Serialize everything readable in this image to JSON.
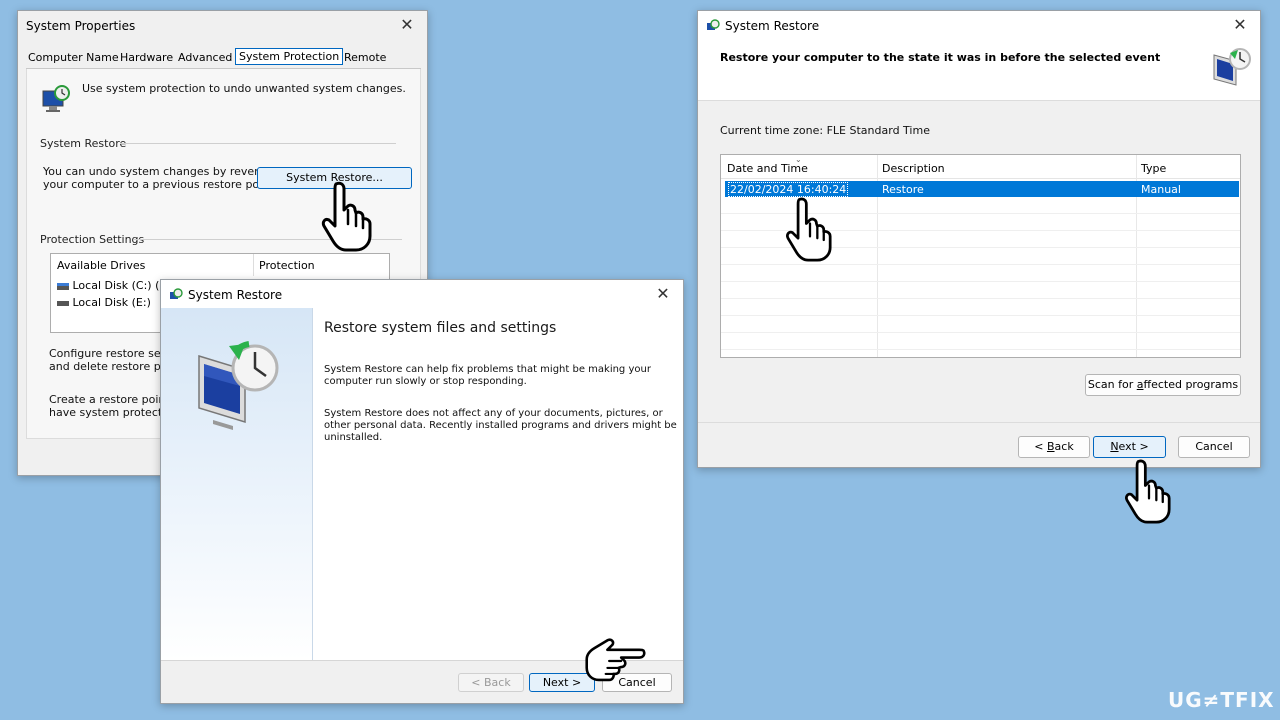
{
  "sysprops": {
    "title": "System Properties",
    "tabs": [
      "Computer Name",
      "Hardware",
      "Advanced",
      "System Protection",
      "Remote"
    ],
    "intro": "Use system protection to undo unwanted system changes.",
    "restore_group": "System Restore",
    "restore_text_1": "You can undo system changes by reverting",
    "restore_text_2": "your computer to a previous restore point.",
    "restore_button": "System Restore...",
    "protection_group": "Protection Settings",
    "col_drives": "Available Drives",
    "col_protection": "Protection",
    "drives": [
      "Local Disk (C:) (Sy",
      "Local Disk (E:)"
    ],
    "configure_1": "Configure restore setting",
    "configure_2": "and delete restore point",
    "create_1": "Create a restore point rig",
    "create_2": "have system protection"
  },
  "wizard": {
    "title": "System Restore",
    "heading": "Restore system files and settings",
    "para1_1": "System Restore can help fix problems that might be making your",
    "para1_2": "computer run slowly or stop responding.",
    "para2_1": "System Restore does not affect any of your documents, pictures, or",
    "para2_2": "other personal data. Recently installed programs and drivers might be",
    "para2_3": "uninstalled.",
    "back": "< Back",
    "next": "Next >",
    "cancel": "Cancel"
  },
  "restore_points": {
    "title": "System Restore",
    "heading": "Restore your computer to the state it was in before the selected event",
    "timezone": "Current time zone: FLE Standard Time",
    "columns": [
      "Date and Time",
      "Description",
      "Type"
    ],
    "rows": [
      {
        "date": "22/02/2024 16:40:24",
        "description": "Restore",
        "type": "Manual"
      }
    ],
    "scan_button": "Scan for affected programs",
    "back": "< Back",
    "next": "Next >",
    "cancel": "Cancel"
  },
  "watermark": "UG≠TFIX",
  "colors": {
    "selection": "#0078d7",
    "accent_border": "#0067c0",
    "desktop": "#8fbde3"
  }
}
